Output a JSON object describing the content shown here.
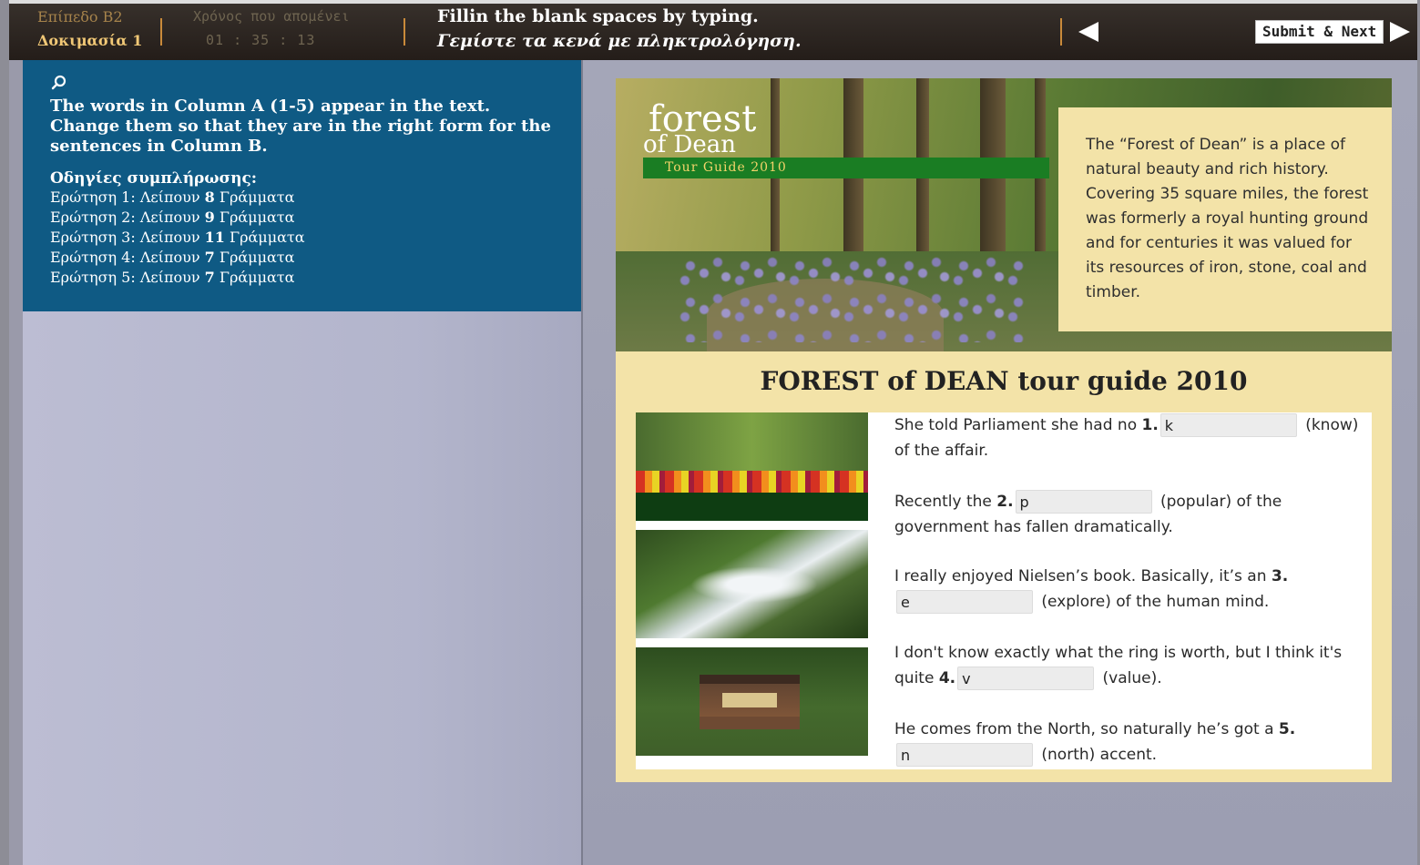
{
  "topbar": {
    "level": "Επίπεδο Β2",
    "test": "Δοκιμασία 1",
    "timer_label": "Χρόνος που απομένει",
    "timer": "01 : 35 : 13",
    "instruction_en": "Fillin the blank spaces by typing.",
    "instruction_gr": "Γεμίστε τα κενά με πληκτρολόγηση.",
    "submit_label": "Submit & Next"
  },
  "left": {
    "main_instruction": "The words in Column A (1-5) appear in the text. Change them so that they are in the right form for the sentences in Column B.",
    "completion_heading": "Οδηγίες συμπλήρωσης:",
    "items": [
      {
        "prefix": "Ερώτηση 1: Λείπουν ",
        "count": "8",
        "suffix": " Γράμματα"
      },
      {
        "prefix": "Ερώτηση 2: Λείπουν ",
        "count": "9",
        "suffix": " Γράμματα"
      },
      {
        "prefix": "Ερώτηση 3: Λείπουν ",
        "count": "11",
        "suffix": " Γράμματα"
      },
      {
        "prefix": "Ερώτηση 4: Λείπουν ",
        "count": "7",
        "suffix": " Γράμματα"
      },
      {
        "prefix": "Ερώτηση 5: Λείπουν ",
        "count": "7",
        "suffix": " Γράμματα"
      }
    ]
  },
  "card": {
    "logo_line1": "forest",
    "logo_line2": "of Dean",
    "tour_label": "Tour Guide 2010",
    "about": "The “Forest of Dean” is a place of natural beauty and rich history. Covering 35 square miles, the forest was formerly a royal hunting ground and for centuries it was valued for its resources of iron, stone, coal and timber.",
    "title": "FOREST of DEAN tour guide 2010"
  },
  "questions": [
    {
      "before": "She told Parliament she had no ",
      "num": "1.",
      "value": "k",
      "after": " (know) of the affair."
    },
    {
      "before": "Recently the ",
      "num": "2.",
      "value": "p",
      "after": " (popular) of the government has fallen dramatically."
    },
    {
      "before": "I really enjoyed Nielsen’s book. Basically, it’s an ",
      "num": "3.",
      "value": "e",
      "after": " (explore) of the human mind."
    },
    {
      "before": "I don't know exactly what the ring is worth, but I think it's quite ",
      "num": "4.",
      "value": "v",
      "after": " (value)."
    },
    {
      "before": "He comes from the North, so naturally he’s got a ",
      "num": "5.",
      "value": "n",
      "after": " (north) accent."
    }
  ],
  "icons": {
    "search": "search-icon",
    "prev": "left-arrow-icon",
    "next": "right-arrow-icon"
  }
}
